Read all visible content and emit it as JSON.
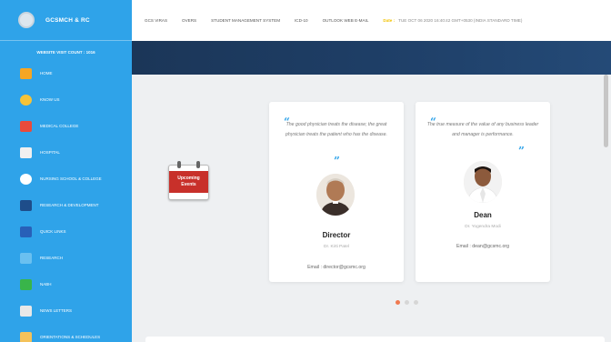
{
  "brand": {
    "title": "GCSMCH & RC"
  },
  "sidebar": {
    "visit_label": "WEBSITE VISIT COUNT : 1016",
    "items": [
      {
        "label": "HOME",
        "color": "#f5a623"
      },
      {
        "label": "KNOW US",
        "color": "#f6c338"
      },
      {
        "label": "MEDICAL COLLEGE",
        "color": "#e94b3c"
      },
      {
        "label": "HOSPITAL",
        "color": "#f0f0f0"
      },
      {
        "label": "NURSING SCHOOL & COLLEGE",
        "color": "#ffffff"
      },
      {
        "label": "RESEARCH & DEVELOPMENT",
        "color": "#1e4d8a"
      },
      {
        "label": "QUICK LINKS",
        "color": "#2860b8"
      },
      {
        "label": "RESEARCH",
        "color": "#6ac0f0"
      },
      {
        "label": "NABH",
        "color": "#39b54a"
      },
      {
        "label": "NEWS LETTERS",
        "color": "#e8e8e8"
      },
      {
        "label": "ORIENTATIONS & SCHEDULES",
        "color": "#f4c25a"
      }
    ]
  },
  "topbar": {
    "links": [
      "GCS VIRAS",
      "OVERS",
      "STUDENT MANAGEMENT SYSTEM",
      "ICD-10",
      "OUTLOOK WEB E-MAIL"
    ],
    "date_label": "Date :",
    "date": "TUE OCT 06 2020 16:40:42 GMT+0530 (INDIA STANDARD TIME)"
  },
  "events": {
    "label_line1": "Upcoming",
    "label_line2": "Events"
  },
  "cards": [
    {
      "quote": "The good physician treats the disease; the great physician treats the patient who has the disease.",
      "title": "Director",
      "name": "Dr. Kirti Patel",
      "email": "Email : director@gcsmc.org"
    },
    {
      "quote": "The true measure of the value of any business leader and manager is performance.",
      "title": "Dean",
      "name": "Dr. Yogendra Modi",
      "email": "Email : dean@gcsmc.org"
    }
  ],
  "carousel": {
    "count": 3,
    "active_index": 0,
    "active_color": "#f07a50"
  },
  "colors": {
    "sidebar": "#2fa3e9",
    "banner": "#1e3e66",
    "accent": "#2fa3e9"
  }
}
